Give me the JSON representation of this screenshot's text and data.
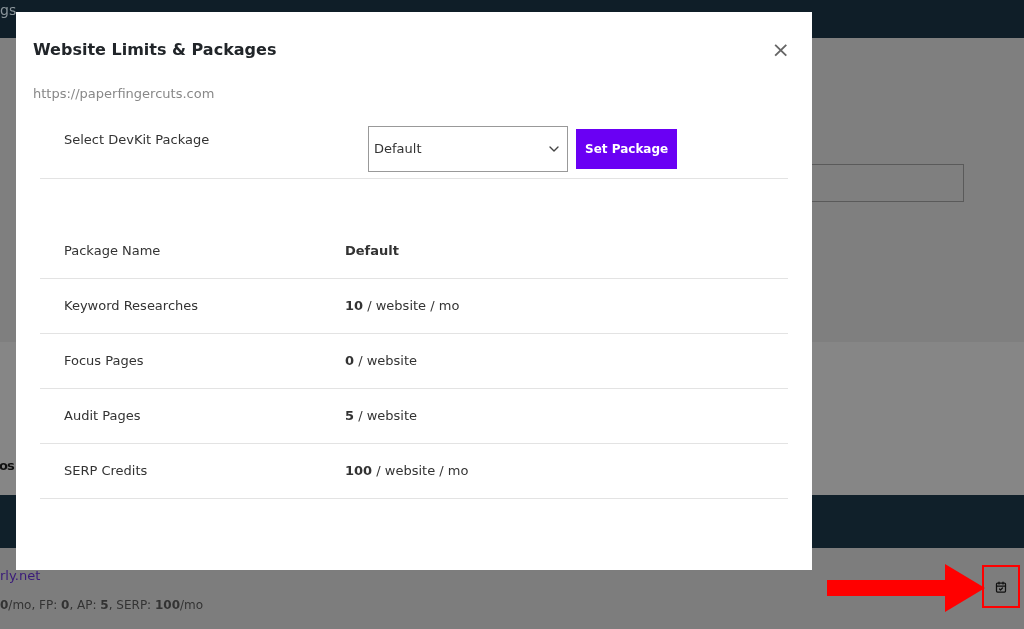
{
  "background": {
    "header_text": "gs",
    "section_heading": "os",
    "site_link": "rly.net",
    "site_limits": "**0**/mo, FP: **0**, AP: **5**, SERP: **100**/mo"
  },
  "dialog": {
    "title": "Website Limits & Packages",
    "close": "×",
    "url": "https://paperfingercuts.com",
    "package_select": {
      "label": "Select DevKit Package",
      "value": "Default",
      "button": "Set Package"
    },
    "rows": [
      {
        "label": "Package Name",
        "value": "**Default**"
      },
      {
        "label": "Keyword Researches",
        "value": "**10** / website / mo"
      },
      {
        "label": "Focus Pages",
        "value": "**0** / website"
      },
      {
        "label": "Audit Pages",
        "value": "**5** / website"
      },
      {
        "label": "SERP Credits",
        "value": "**100** / website / mo"
      }
    ]
  }
}
